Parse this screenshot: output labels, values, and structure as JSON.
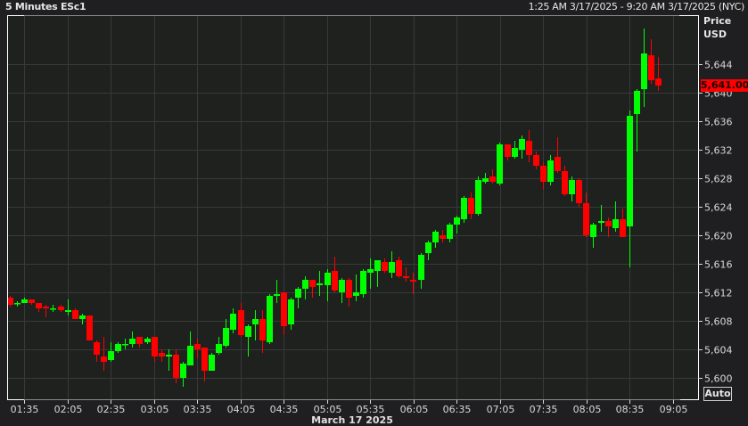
{
  "header": {
    "title": "5 Minutes ESc1",
    "range": "1:25 AM 3/17/2025 - 9:20 AM 3/17/2025 (NYC)"
  },
  "price_axis": {
    "title": "Price",
    "currency": "USD",
    "last_price_label": "5,641.00",
    "auto_label": "Auto"
  },
  "time_axis": {
    "date_label": "March 17 2025"
  },
  "colors": {
    "up": "#00ff00",
    "down": "#ff0000",
    "grid": "#38393a",
    "plot_bg": "#1f211f",
    "last_price": "#ff0000"
  },
  "chart_data": {
    "type": "candlestick",
    "title": "5 Minutes ESc1",
    "xlabel": "March 17 2025",
    "ylabel": "Price USD",
    "ylim": [
      5597,
      5651
    ],
    "y_ticks": [
      5600,
      5604,
      5608,
      5612,
      5616,
      5620,
      5624,
      5628,
      5632,
      5636,
      5640,
      5644
    ],
    "y_tick_labels": [
      "5,600",
      "5,604",
      "5,608",
      "5,612",
      "5,616",
      "5,620",
      "5,624",
      "5,628",
      "5,632",
      "5,636",
      "5,640",
      "5,644"
    ],
    "x_tick_labels": [
      "01:35",
      "02:05",
      "02:35",
      "03:05",
      "03:35",
      "04:05",
      "04:35",
      "05:05",
      "05:35",
      "06:05",
      "06:35",
      "07:05",
      "07:35",
      "08:05",
      "08:35",
      "09:05"
    ],
    "start_time": "01:25",
    "interval_minutes": 5,
    "grid": true,
    "last_price": 5641.0,
    "ohlc_fields": [
      "open",
      "high",
      "low",
      "close"
    ],
    "ohlc": [
      [
        5611.25,
        5611.5,
        5610,
        5610.25
      ],
      [
        5610.5,
        5610.75,
        5610,
        5610.5
      ],
      [
        5610.5,
        5611.25,
        5610.5,
        5611
      ],
      [
        5611,
        5611,
        5610.25,
        5610.5
      ],
      [
        5610.5,
        5610.5,
        5609.25,
        5609.75
      ],
      [
        5610,
        5610.25,
        5608.5,
        5609.75
      ],
      [
        5609.75,
        5610.25,
        5609.25,
        5609.75
      ],
      [
        5610,
        5610.25,
        5609.25,
        5609.5
      ],
      [
        5609.25,
        5611,
        5608.75,
        5609.5
      ],
      [
        5609.5,
        5609.75,
        5608.25,
        5608.25
      ],
      [
        5608.25,
        5609,
        5607.5,
        5608.75
      ],
      [
        5608.75,
        5608.75,
        5605.25,
        5605.25
      ],
      [
        5605,
        5605.25,
        5602.25,
        5603.25
      ],
      [
        5603,
        5605.75,
        5601,
        5602.25
      ],
      [
        5602.5,
        5605,
        5602.25,
        5603.75
      ],
      [
        5603.75,
        5605,
        5603.5,
        5604.75
      ],
      [
        5604.75,
        5605.5,
        5604,
        5604.75
      ],
      [
        5604.75,
        5606.5,
        5604.25,
        5605.5
      ],
      [
        5605.75,
        5605.75,
        5604.25,
        5604.75
      ],
      [
        5605,
        5605.75,
        5604.75,
        5605.5
      ],
      [
        5605.75,
        5605.75,
        5602.25,
        5603
      ],
      [
        5603.5,
        5604,
        5602.25,
        5603
      ],
      [
        5603,
        5604,
        5601,
        5603.25
      ],
      [
        5603.25,
        5604,
        5599.25,
        5600
      ],
      [
        5600,
        5602.25,
        5598.75,
        5602
      ],
      [
        5601.75,
        5606.5,
        5601.75,
        5604.5
      ],
      [
        5604.75,
        5605.5,
        5602.75,
        5604
      ],
      [
        5604.25,
        5604.25,
        5599.5,
        5601
      ],
      [
        5601,
        5603.5,
        5601,
        5603.25
      ],
      [
        5603.5,
        5605.75,
        5603.25,
        5604.75
      ],
      [
        5604.5,
        5608.25,
        5604.25,
        5607
      ],
      [
        5606.75,
        5609.75,
        5606.25,
        5609
      ],
      [
        5609.5,
        5610.5,
        5605.75,
        5606
      ],
      [
        5605.75,
        5607.5,
        5603,
        5607.25
      ],
      [
        5607.5,
        5609.5,
        5605.25,
        5608.25
      ],
      [
        5608.25,
        5609.5,
        5603.5,
        5605.25
      ],
      [
        5605,
        5611.75,
        5604.75,
        5611.5
      ],
      [
        5611.5,
        5613.75,
        5610.5,
        5611.75
      ],
      [
        5612,
        5612,
        5606,
        5607.25
      ],
      [
        5607.5,
        5611.25,
        5606.75,
        5611
      ],
      [
        5611.25,
        5612.75,
        5609.75,
        5612.5
      ],
      [
        5612.5,
        5614.25,
        5611,
        5613.75
      ],
      [
        5613.75,
        5613.75,
        5611.25,
        5612.75
      ],
      [
        5613,
        5615,
        5611.5,
        5613.25
      ],
      [
        5613,
        5615.25,
        5610.75,
        5614.75
      ],
      [
        5615,
        5617,
        5612,
        5612.25
      ],
      [
        5612,
        5614,
        5610.5,
        5613.75
      ],
      [
        5613.75,
        5614,
        5610,
        5611.25
      ],
      [
        5611.5,
        5614.5,
        5610.75,
        5612
      ],
      [
        5611.75,
        5615.25,
        5611.25,
        5615
      ],
      [
        5614.75,
        5616.75,
        5612.5,
        5615.25
      ],
      [
        5615,
        5616.5,
        5612.75,
        5616.5
      ],
      [
        5616.25,
        5616.75,
        5614.75,
        5615
      ],
      [
        5614.75,
        5617.75,
        5614,
        5616.25
      ],
      [
        5616.5,
        5617,
        5614,
        5614.25
      ],
      [
        5614.25,
        5615.5,
        5613.5,
        5614
      ],
      [
        5613.75,
        5614.75,
        5611.75,
        5613.5
      ],
      [
        5613.75,
        5617.5,
        5612.5,
        5617.25
      ],
      [
        5617.5,
        5619.25,
        5616.5,
        5619
      ],
      [
        5619,
        5620.75,
        5618.25,
        5620.5
      ],
      [
        5620,
        5620.75,
        5619,
        5619.5
      ],
      [
        5619.5,
        5621.75,
        5619,
        5621.5
      ],
      [
        5621.5,
        5622.75,
        5620.25,
        5622.5
      ],
      [
        5622.25,
        5625.5,
        5621.75,
        5625.25
      ],
      [
        5625.25,
        5626,
        5622.25,
        5623
      ],
      [
        5623,
        5628.25,
        5622.75,
        5627.75
      ],
      [
        5627.5,
        5628.75,
        5627.25,
        5628
      ],
      [
        5628.25,
        5629.25,
        5627.25,
        5627.5
      ],
      [
        5627.25,
        5633,
        5627,
        5632.75
      ],
      [
        5632.75,
        5632.75,
        5630.5,
        5631
      ],
      [
        5631,
        5633.25,
        5630.75,
        5632.25
      ],
      [
        5632,
        5634,
        5630.75,
        5633.5
      ],
      [
        5633.25,
        5634.75,
        5630.25,
        5631.25
      ],
      [
        5631.25,
        5631.75,
        5629.25,
        5629.75
      ],
      [
        5629.75,
        5630.25,
        5626.5,
        5627.5
      ],
      [
        5627.5,
        5631.25,
        5627,
        5630.5
      ],
      [
        5631,
        5633.75,
        5628.75,
        5629
      ],
      [
        5629,
        5629.75,
        5625.5,
        5625.75
      ],
      [
        5625.75,
        5628.25,
        5624.75,
        5627.75
      ],
      [
        5627.75,
        5628,
        5624,
        5624.5
      ],
      [
        5624.5,
        5626,
        5619.75,
        5620
      ],
      [
        5619.75,
        5621.75,
        5618.25,
        5621.5
      ],
      [
        5621.75,
        5624.25,
        5620.5,
        5622
      ],
      [
        5622,
        5622.5,
        5619.75,
        5621.25
      ],
      [
        5621,
        5624.75,
        5620.5,
        5622.25
      ],
      [
        5622.25,
        5623.75,
        5619.75,
        5619.75
      ],
      [
        5621.25,
        5637.5,
        5615.5,
        5636.75
      ],
      [
        5637,
        5640.5,
        5631.75,
        5640.25
      ],
      [
        5640.5,
        5649,
        5638,
        5645.5
      ],
      [
        5645.25,
        5647.5,
        5641.25,
        5641.75
      ],
      [
        5642,
        5645,
        5640.25,
        5641
      ]
    ]
  }
}
